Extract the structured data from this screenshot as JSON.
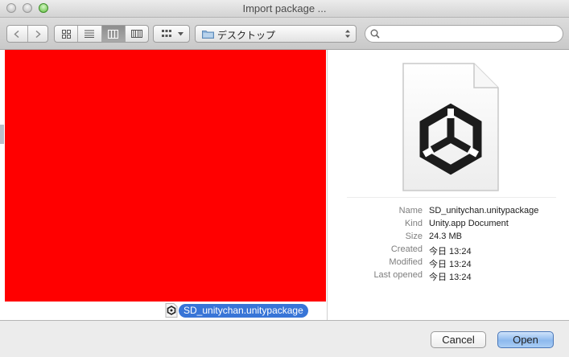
{
  "window": {
    "title": "Import package ..."
  },
  "toolbar": {
    "location": "デスクトップ",
    "search": {
      "value": "",
      "placeholder": ""
    }
  },
  "file_list": {
    "selected_file": "SD_unitychan.unitypackage"
  },
  "preview": {
    "icon": "unity-logo-icon",
    "info": [
      {
        "key": "Name",
        "value": "SD_unitychan.unitypackage"
      },
      {
        "key": "Kind",
        "value": "Unity.app Document"
      },
      {
        "key": "Size",
        "value": "24.3 MB"
      },
      {
        "key": "Created",
        "value": "今日 13:24"
      },
      {
        "key": "Modified",
        "value": "今日 13:24"
      },
      {
        "key": "Last opened",
        "value": "今日 13:24"
      }
    ]
  },
  "buttons": {
    "cancel": "Cancel",
    "open": "Open"
  },
  "colors": {
    "selection": "#3875d7",
    "preview_placeholder": "#ff0000"
  }
}
